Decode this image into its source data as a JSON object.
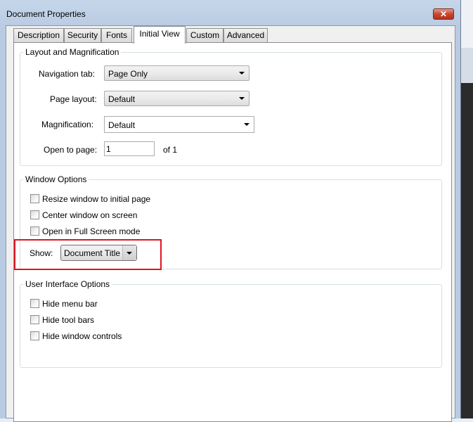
{
  "window": {
    "title": "Document Properties",
    "close_glyph": "✕"
  },
  "tabs": [
    {
      "label": "Description"
    },
    {
      "label": "Security"
    },
    {
      "label": "Fonts"
    },
    {
      "label": "Initial View",
      "active": true
    },
    {
      "label": "Custom"
    },
    {
      "label": "Advanced"
    }
  ],
  "layout_group": {
    "title": "Layout and Magnification",
    "navigation_tab": {
      "label": "Navigation tab:",
      "value": "Page Only"
    },
    "page_layout": {
      "label": "Page layout:",
      "value": "Default"
    },
    "magnification": {
      "label": "Magnification:",
      "value": "Default"
    },
    "open_to_page": {
      "label": "Open to page:",
      "value": "1",
      "of_text": "of 1"
    }
  },
  "window_options": {
    "title": "Window Options",
    "checkboxes": [
      {
        "label": "Resize window to initial page",
        "checked": false
      },
      {
        "label": "Center window on screen",
        "checked": false
      },
      {
        "label": "Open in Full Screen mode",
        "checked": false
      }
    ],
    "show": {
      "label": "Show:",
      "value": "Document Title"
    },
    "highlight_color": "#e0141e"
  },
  "ui_options": {
    "title": "User Interface Options",
    "checkboxes": [
      {
        "label": "Hide menu bar",
        "checked": false
      },
      {
        "label": "Hide tool bars",
        "checked": false
      },
      {
        "label": "Hide window controls",
        "checked": false
      }
    ]
  }
}
